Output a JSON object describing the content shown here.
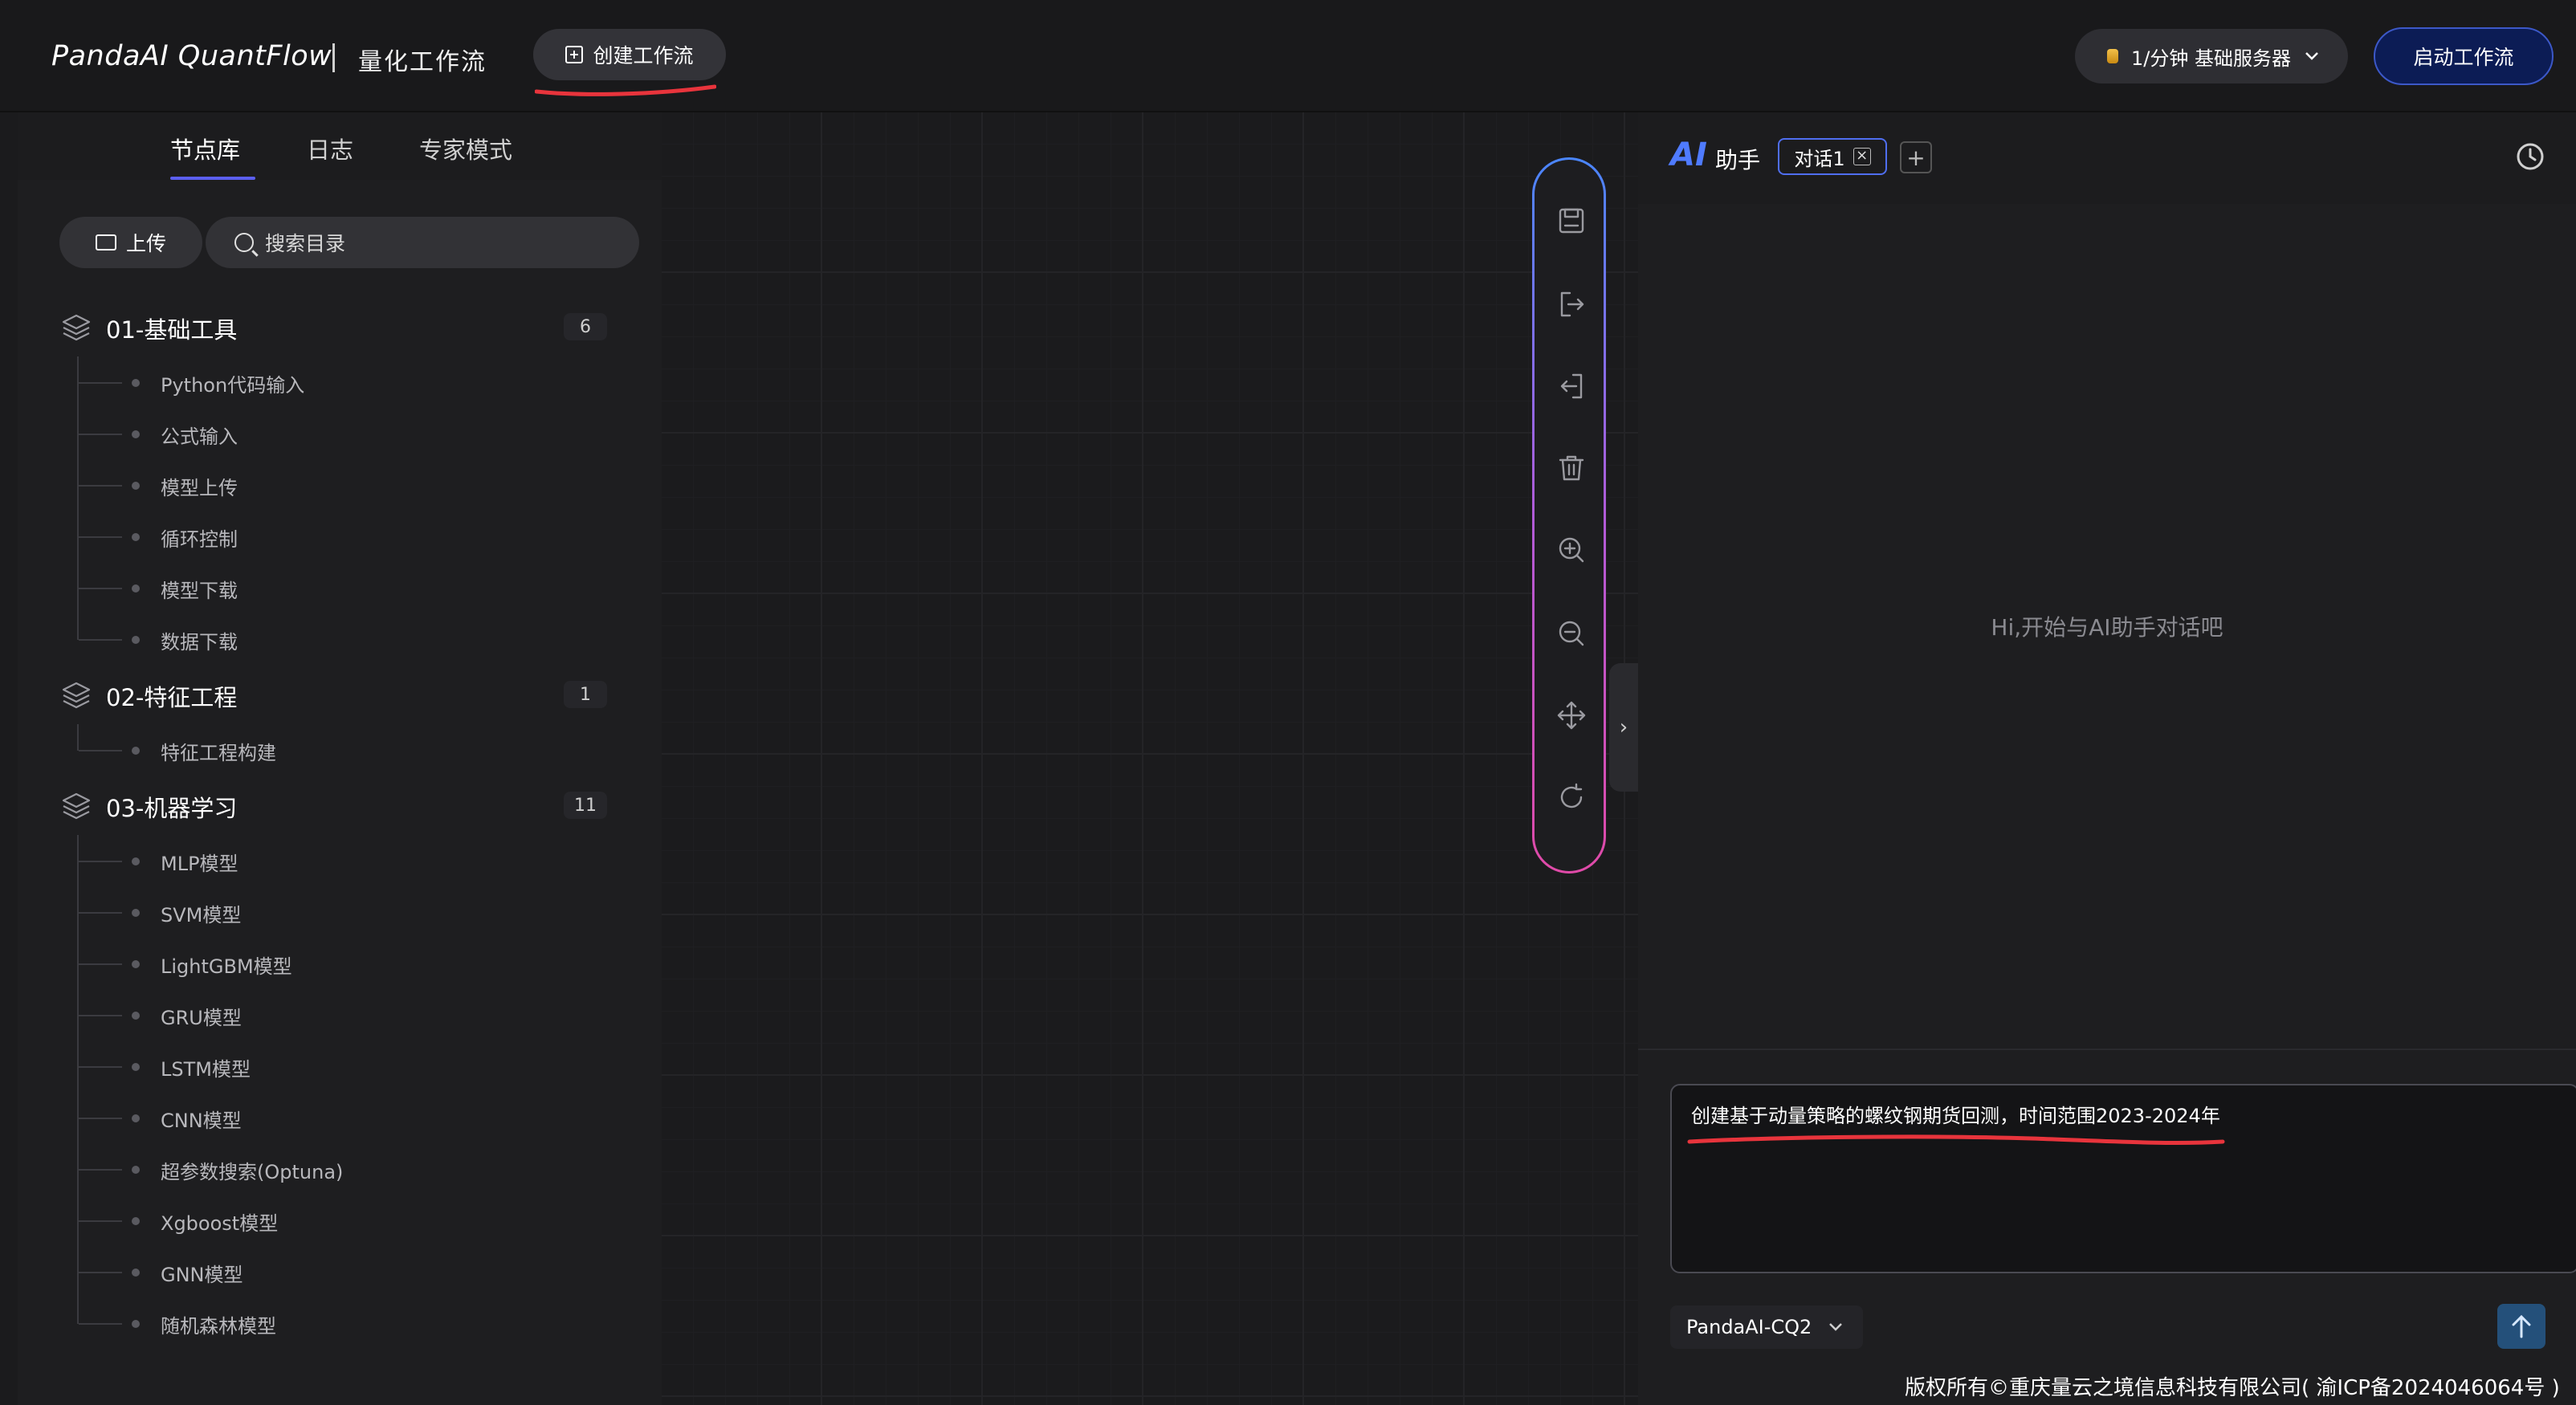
{
  "app": {
    "brand": "PandaAI QuantFlow",
    "subtitle": "量化工作流",
    "create_button": "创建工作流",
    "server_selector": "1/分钟  基础服务器",
    "start_button": "启动工作流"
  },
  "left_panel": {
    "tabs": [
      "节点库",
      "日志",
      "专家模式"
    ],
    "active_tab": "节点库",
    "upload_label": "上传",
    "search_placeholder": "搜索目录",
    "groups": [
      {
        "title": "01-基础工具",
        "count": "6",
        "items": [
          "Python代码输入",
          "公式输入",
          "模型上传",
          "循环控制",
          "模型下载",
          "数据下载"
        ]
      },
      {
        "title": "02-特征工程",
        "count": "1",
        "items": [
          "特征工程构建"
        ]
      },
      {
        "title": "03-机器学习",
        "count": "11",
        "items": [
          "MLP模型",
          "SVM模型",
          "LightGBM模型",
          "GRU模型",
          "LSTM模型",
          "CNN模型",
          "超参数搜索(Optuna)",
          "Xgboost模型",
          "GNN模型",
          "随机森林模型"
        ]
      }
    ]
  },
  "toolbar": {
    "tools": [
      "save-icon",
      "export-icon",
      "import-icon",
      "delete-icon",
      "zoom-in-icon",
      "zoom-out-icon",
      "move-icon",
      "refresh-icon"
    ]
  },
  "ai_panel": {
    "logo": "AI",
    "title": "助手",
    "conversation_tab": "对话1",
    "empty_message": "Hi,开始与AI助手对话吧",
    "input_value": "创建基于动量策略的螺纹钢期货回测，时间范围2023-2024年",
    "model": "PandaAI-CQ2"
  },
  "footer": "版权所有©重庆量云之境信息科技有限公司( 渝ICP备2024046064号 )",
  "colors": {
    "accent": "#5b5ff0",
    "annotation_red": "#e8343c",
    "start_button": "#0c1c55"
  }
}
